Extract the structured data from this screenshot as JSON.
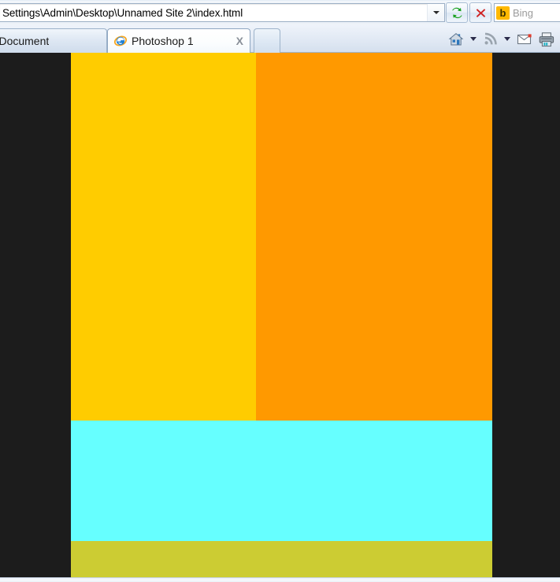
{
  "browser": {
    "name": "Internet Explorer",
    "address_bar": {
      "value": "Settings\\Admin\\Desktop\\Unnamed Site 2\\index.html",
      "dropdown_icon": "chevron-down-icon",
      "refresh_icon": "refresh-icon",
      "stop_icon": "stop-icon"
    },
    "search": {
      "provider_label": "Bing",
      "provider_glyph": "b",
      "placeholder": "Bing"
    },
    "tabs": [
      {
        "label": "titled Document",
        "active": false,
        "icon": ""
      },
      {
        "label": "Photoshop 1",
        "active": true,
        "icon": "ie-icon",
        "close_label": "X"
      },
      {
        "label": "",
        "active": false,
        "icon": "new-tab-icon"
      }
    ],
    "toolbar_right": [
      {
        "name": "home-icon",
        "label": "Home"
      },
      {
        "name": "home-dropdown-icon",
        "label": ""
      },
      {
        "name": "feeds-icon",
        "label": "Feeds"
      },
      {
        "name": "feeds-dropdown-icon",
        "label": ""
      },
      {
        "name": "mail-icon",
        "label": "Read mail"
      },
      {
        "name": "print-icon",
        "label": "Print"
      }
    ]
  },
  "page_content": {
    "background_color": "#1c1c1c",
    "blocks": [
      {
        "name": "yellow-block",
        "color": "#FFCC00"
      },
      {
        "name": "orange-block",
        "color": "#FF9900"
      },
      {
        "name": "cyan-block",
        "color": "#66FFFF"
      },
      {
        "name": "olive-block",
        "color": "#CCCC33"
      }
    ]
  }
}
